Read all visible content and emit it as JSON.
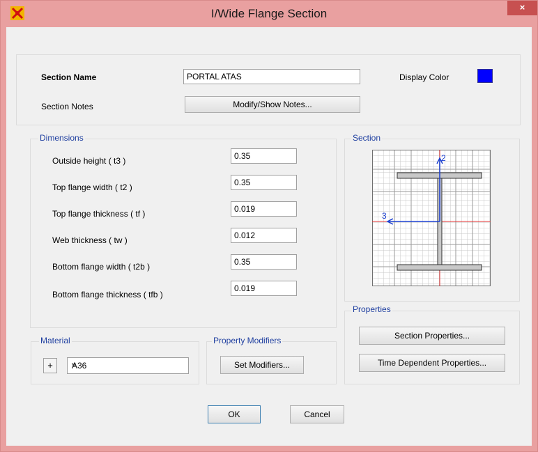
{
  "window": {
    "title": "I/Wide Flange Section",
    "close_glyph": "×",
    "app_icon": "sap-app-icon"
  },
  "section": {
    "name_label": "Section Name",
    "name_value": "PORTAL ATAS",
    "notes_label": "Section Notes",
    "notes_button": "Modify/Show Notes...",
    "display_color_label": "Display Color",
    "display_color": "#0000ff"
  },
  "dimensions": {
    "title": "Dimensions",
    "rows": [
      {
        "label": "Outside height  ( t3 )",
        "value": "0.35"
      },
      {
        "label": "Top flange width  ( t2 )",
        "value": "0.35"
      },
      {
        "label": "Top flange thickness  ( tf )",
        "value": "0.019"
      },
      {
        "label": "Web thickness  ( tw )",
        "value": "0.012"
      },
      {
        "label": "Bottom flange width  ( t2b )",
        "value": "0.35"
      },
      {
        "label": "Bottom flange thickness  ( tfb )",
        "value": "0.019"
      }
    ]
  },
  "section_preview": {
    "title": "Section",
    "axis_2": "2",
    "axis_3": "3"
  },
  "properties": {
    "title": "Properties",
    "section_properties_button": "Section Properties...",
    "time_dependent_button": "Time Dependent Properties..."
  },
  "material": {
    "title": "Material",
    "plus_glyph": "+",
    "selected": "A36",
    "chevron": "v"
  },
  "modifiers": {
    "title": "Property Modifiers",
    "set_button": "Set Modifiers..."
  },
  "buttons": {
    "ok": "OK",
    "cancel": "Cancel"
  }
}
